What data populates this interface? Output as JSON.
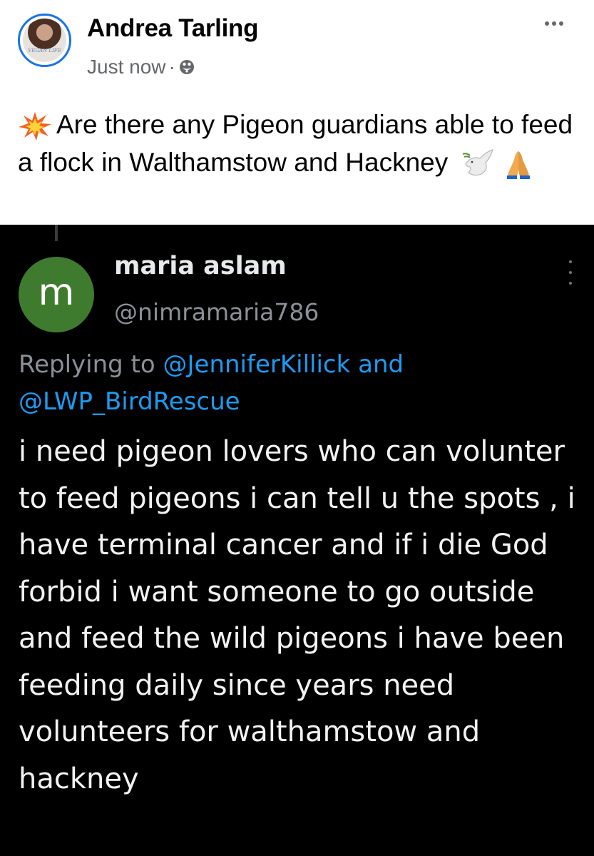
{
  "post": {
    "author": "Andrea Tarling",
    "avatar_text": "VEGAN LIFE",
    "timestamp": "Just now",
    "separator": "·",
    "audience_icon": "public-globe-icon",
    "text": "Are there any Pigeon guardians able to feed a flock in Walthamstow and Hackney",
    "leading_emoji": "collision-emoji",
    "trailing_emojis": [
      "dove-emoji",
      "folded-hands-emoji"
    ]
  },
  "tweet": {
    "avatar_letter": "m",
    "name": "maria aslam",
    "handle": "@nimramaria786",
    "replying_prefix": "Replying to",
    "mention_1": "@JenniferKillick",
    "replying_and": "and",
    "mention_2": "@LWP_BirdRescue",
    "body": "i need pigeon lovers who can volunter to feed pigeons i can tell u the spots , i have terminal cancer and if i die God forbid i want someone to go outside and feed the wild pigeons i have been feeding daily since years need volunteers for walthamstow and hackney"
  },
  "colors": {
    "facebook_blue": "#1b74e4",
    "tweet_background": "#000000",
    "mention_blue": "#1d9bf0",
    "avatar_green": "#3f7b2e",
    "secondary_text": "#65676b"
  }
}
